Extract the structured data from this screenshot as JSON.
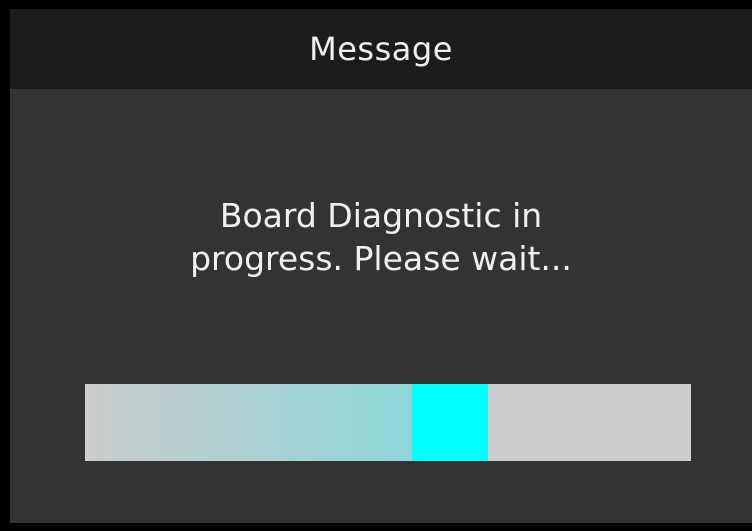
{
  "dialog": {
    "title": "Message",
    "message_line_1": "Board Diagnostic in",
    "message_line_2": "progress. Please wait..."
  },
  "progress": {
    "fraction": 0.665,
    "indicator_fraction": 0.125,
    "colors": {
      "track": "#cccccc",
      "fill_start": "#cccccc",
      "fill_end": "#8dd6d9",
      "indicator": "#00ffff"
    }
  },
  "colors": {
    "background": "#333333",
    "titlebar": "#1c1c1c",
    "text": "#f0f0f0"
  }
}
